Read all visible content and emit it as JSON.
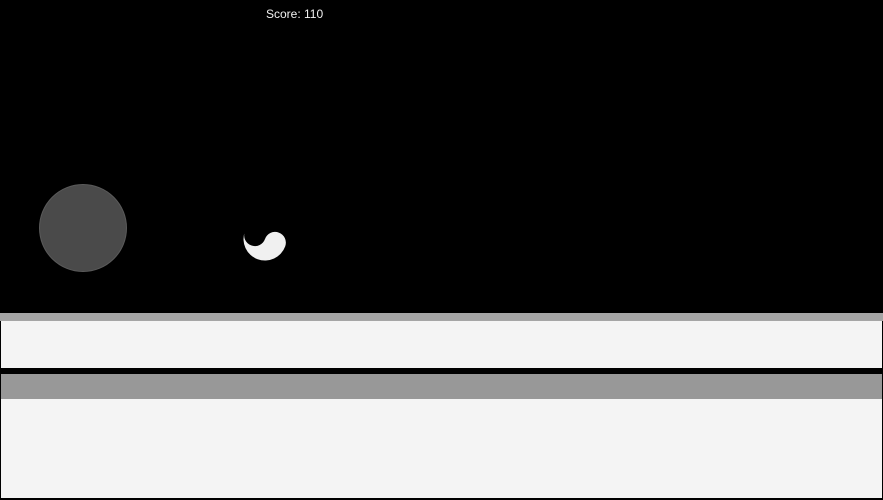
{
  "hud": {
    "score_text": "Score: 110"
  },
  "joystick": {
    "icon": "virtual-joystick"
  },
  "player": {
    "icon": "yin-yang-ball"
  },
  "colors": {
    "background": "#000000",
    "joystick": "#4a4a4a",
    "floor_light": "#f4f4f4",
    "floor_band": "#989898",
    "floor_edge": "#a5a5a5"
  }
}
